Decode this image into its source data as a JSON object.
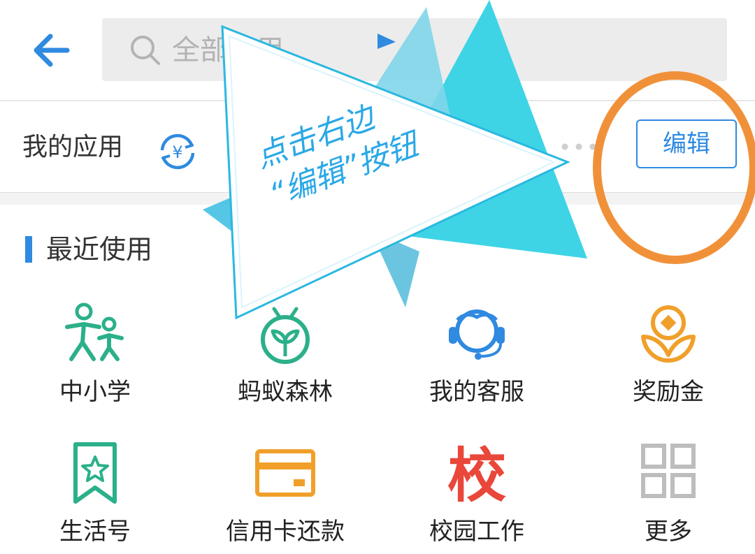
{
  "search": {
    "placeholder": "全部应用"
  },
  "my_apps": {
    "label": "我的应用",
    "edit_label": "编辑"
  },
  "recent": {
    "title": "最近使用",
    "apps": [
      {
        "label": "中小学",
        "icon": "children-icon",
        "color": "#2bb08a"
      },
      {
        "label": "蚂蚁森林",
        "icon": "sprout-icon",
        "color": "#2bb08a"
      },
      {
        "label": "我的客服",
        "icon": "headset-icon",
        "color": "#2f8ae0"
      },
      {
        "label": "奖励金",
        "icon": "reward-coin-icon",
        "color": "#f0a02a"
      },
      {
        "label": "生活号",
        "icon": "bookmark-star-icon",
        "color": "#2bb08a"
      },
      {
        "label": "信用卡还款",
        "icon": "credit-card-icon",
        "color": "#f0a02a"
      },
      {
        "label": "校园工作",
        "icon": "school-char-icon",
        "color": "#e9473a",
        "glyph": "校"
      },
      {
        "label": "更多",
        "icon": "grid-more-icon",
        "color": "#bdbdbd"
      }
    ]
  },
  "annotation": {
    "line1": "点击右边",
    "line2": "“编辑”按钮"
  },
  "colors": {
    "accent": "#2f8ae0",
    "highlight_circle": "#f0913a",
    "triangle": "#3ed4e6"
  }
}
